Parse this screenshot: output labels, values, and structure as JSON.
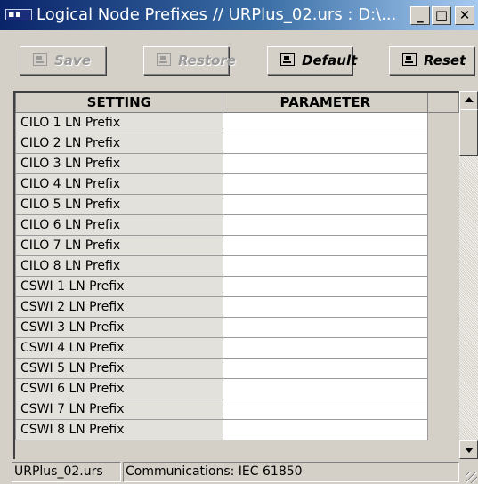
{
  "window": {
    "title": "Logical Node Prefixes // URPlus_02.urs : D:\\...",
    "controls": {
      "minimize": "_",
      "maximize": "□",
      "close": "✕"
    }
  },
  "toolbar": {
    "save": {
      "label": "Save",
      "icon": "save-icon",
      "enabled": false
    },
    "restore": {
      "label": "Restore",
      "icon": "restore-icon",
      "enabled": false
    },
    "default": {
      "label": "Default",
      "icon": "default-icon",
      "enabled": true
    },
    "reset": {
      "label": "Reset",
      "icon": "reset-icon",
      "enabled": true
    }
  },
  "grid": {
    "headers": {
      "setting": "SETTING",
      "parameter": "PARAMETER"
    },
    "rows": [
      {
        "setting": "CILO 1 LN Prefix",
        "parameter": ""
      },
      {
        "setting": "CILO 2 LN Prefix",
        "parameter": ""
      },
      {
        "setting": "CILO 3 LN Prefix",
        "parameter": ""
      },
      {
        "setting": "CILO 4 LN Prefix",
        "parameter": ""
      },
      {
        "setting": "CILO 5 LN Prefix",
        "parameter": ""
      },
      {
        "setting": "CILO 6 LN Prefix",
        "parameter": ""
      },
      {
        "setting": "CILO 7 LN Prefix",
        "parameter": ""
      },
      {
        "setting": "CILO 8 LN Prefix",
        "parameter": ""
      },
      {
        "setting": "CSWI 1 LN Prefix",
        "parameter": ""
      },
      {
        "setting": "CSWI 2 LN Prefix",
        "parameter": ""
      },
      {
        "setting": "CSWI 3 LN Prefix",
        "parameter": ""
      },
      {
        "setting": "CSWI 4 LN Prefix",
        "parameter": ""
      },
      {
        "setting": "CSWI 5 LN Prefix",
        "parameter": ""
      },
      {
        "setting": "CSWI 6 LN Prefix",
        "parameter": ""
      },
      {
        "setting": "CSWI 7 LN Prefix",
        "parameter": ""
      },
      {
        "setting": "CSWI 8 LN Prefix",
        "parameter": ""
      }
    ]
  },
  "statusbar": {
    "file": "URPlus_02.urs",
    "section": "Communications: IEC 61850"
  },
  "colors": {
    "titlebar_start": "#0a246a",
    "titlebar_end": "#a6caf0",
    "face": "#d4d0c8",
    "setting_cell": "#e3e1dc",
    "parameter_cell": "#ffffff",
    "disabled_text": "#9a9a9a"
  }
}
